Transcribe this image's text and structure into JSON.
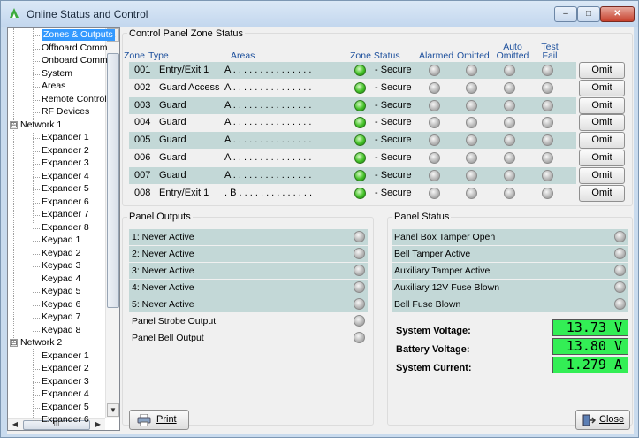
{
  "window": {
    "title": "Online Status and Control",
    "controls": {
      "minimize": "–",
      "maximize": "□",
      "close": "✕"
    }
  },
  "tree": {
    "items": [
      {
        "label": "Zones & Outputs",
        "selected": true
      },
      {
        "label": "Offboard Comm"
      },
      {
        "label": "Onboard Comm"
      },
      {
        "label": "System"
      },
      {
        "label": "Areas"
      },
      {
        "label": "Remote Control"
      },
      {
        "label": "RF Devices"
      },
      {
        "label": "Network 1",
        "toggle": "⊟"
      },
      {
        "label": "Expander 1"
      },
      {
        "label": "Expander 2"
      },
      {
        "label": "Expander 3"
      },
      {
        "label": "Expander 4"
      },
      {
        "label": "Expander 5"
      },
      {
        "label": "Expander 6"
      },
      {
        "label": "Expander 7"
      },
      {
        "label": "Expander 8"
      },
      {
        "label": "Keypad 1"
      },
      {
        "label": "Keypad 2"
      },
      {
        "label": "Keypad 3"
      },
      {
        "label": "Keypad 4"
      },
      {
        "label": "Keypad 5"
      },
      {
        "label": "Keypad 6"
      },
      {
        "label": "Keypad 7"
      },
      {
        "label": "Keypad 8"
      },
      {
        "label": "Network 2",
        "toggle": "⊟"
      },
      {
        "label": "Expander 1"
      },
      {
        "label": "Expander 2"
      },
      {
        "label": "Expander 3"
      },
      {
        "label": "Expander 4"
      },
      {
        "label": "Expander 5"
      },
      {
        "label": "Expander 6"
      }
    ],
    "hscroll_grip": "III"
  },
  "zone_status": {
    "title": "Control Panel Zone Status",
    "headers": {
      "zone": "Zone",
      "type": "Type",
      "areas": "Areas",
      "zone_status": "Zone Status",
      "alarmed": "Alarmed",
      "omitted": "Omitted",
      "auto_omitted": "Auto\nOmitted",
      "test_fail": "Test\nFail"
    },
    "zones": [
      {
        "num": "001",
        "type": "Entry/Exit 1",
        "areas": "A . . . . . . . . . . . . . . .",
        "status": "- Secure",
        "omit": "Omit"
      },
      {
        "num": "002",
        "type": "Guard Access",
        "areas": "A . . . . . . . . . . . . . . .",
        "status": "- Secure",
        "omit": "Omit"
      },
      {
        "num": "003",
        "type": "Guard",
        "areas": "A . . . . . . . . . . . . . . .",
        "status": "- Secure",
        "omit": "Omit"
      },
      {
        "num": "004",
        "type": "Guard",
        "areas": "A . . . . . . . . . . . . . . .",
        "status": "- Secure",
        "omit": "Omit"
      },
      {
        "num": "005",
        "type": "Guard",
        "areas": "A . . . . . . . . . . . . . . .",
        "status": "- Secure",
        "omit": "Omit"
      },
      {
        "num": "006",
        "type": "Guard",
        "areas": "A . . . . . . . . . . . . . . .",
        "status": "- Secure",
        "omit": "Omit"
      },
      {
        "num": "007",
        "type": "Guard",
        "areas": "A . . . . . . . . . . . . . . .",
        "status": "- Secure",
        "omit": "Omit"
      },
      {
        "num": "008",
        "type": "Entry/Exit 1",
        "areas": ". B . . . . . . . . . . . . . .",
        "status": "- Secure",
        "omit": "Omit"
      }
    ]
  },
  "panel_outputs": {
    "title": "Panel Outputs",
    "items": [
      "1: Never Active",
      "2: Never Active",
      "3: Never Active",
      "4: Never Active",
      "5: Never Active",
      "Panel Strobe Output",
      "Panel Bell Output"
    ]
  },
  "panel_status": {
    "title": "Panel Status",
    "items": [
      "Panel Box Tamper Open",
      "Bell Tamper Active",
      "Auxiliary Tamper Active",
      "Auxiliary 12V Fuse Blown",
      "Bell Fuse Blown"
    ],
    "system_voltage_label": "System Voltage:",
    "system_voltage": "13.73 V",
    "battery_voltage_label": "Battery Voltage:",
    "battery_voltage": "13.80 V",
    "system_current_label": "System Current:",
    "system_current": "1.279 A"
  },
  "buttons": {
    "print": "Print",
    "close": "Close"
  },
  "colors": {
    "shaded_row": "#c3d8d7",
    "selection": "#3399ff",
    "lcd": "#33ee55",
    "led_secure": "#44c228"
  }
}
